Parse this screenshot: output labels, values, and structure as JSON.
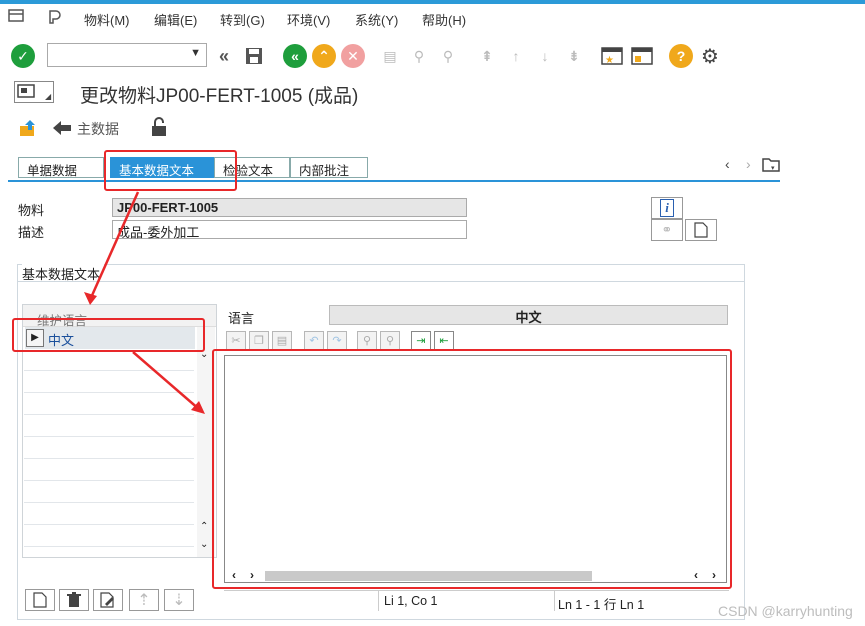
{
  "menu": [
    "物料(M)",
    "编辑(E)",
    "转到(G)",
    "环境(V)",
    "系统(Y)",
    "帮助(H)"
  ],
  "title": "更改物料JP00-FERT-1005 (成品)",
  "app_toolbar": {
    "main_data": "主数据"
  },
  "tabs": [
    "单据数据",
    "基本数据文本",
    "检验文本",
    "内部批注"
  ],
  "fields": {
    "material_label": "物料",
    "material_value": "JP00-FERT-1005",
    "desc_label": "描述",
    "desc_value": "成品-委外加工"
  },
  "group_title": "基本数据文本",
  "left_panel": {
    "header": "维护语言",
    "item": "中文"
  },
  "language_label": "语言",
  "language_value": "中文",
  "status": {
    "pos": "Li 1, Co 1",
    "lines": "Ln 1 - 1 行 Ln 1"
  },
  "watermark": "CSDN @karryhunting",
  "colors": {
    "accent": "#2a93d8",
    "annotation": "#e8282a"
  }
}
